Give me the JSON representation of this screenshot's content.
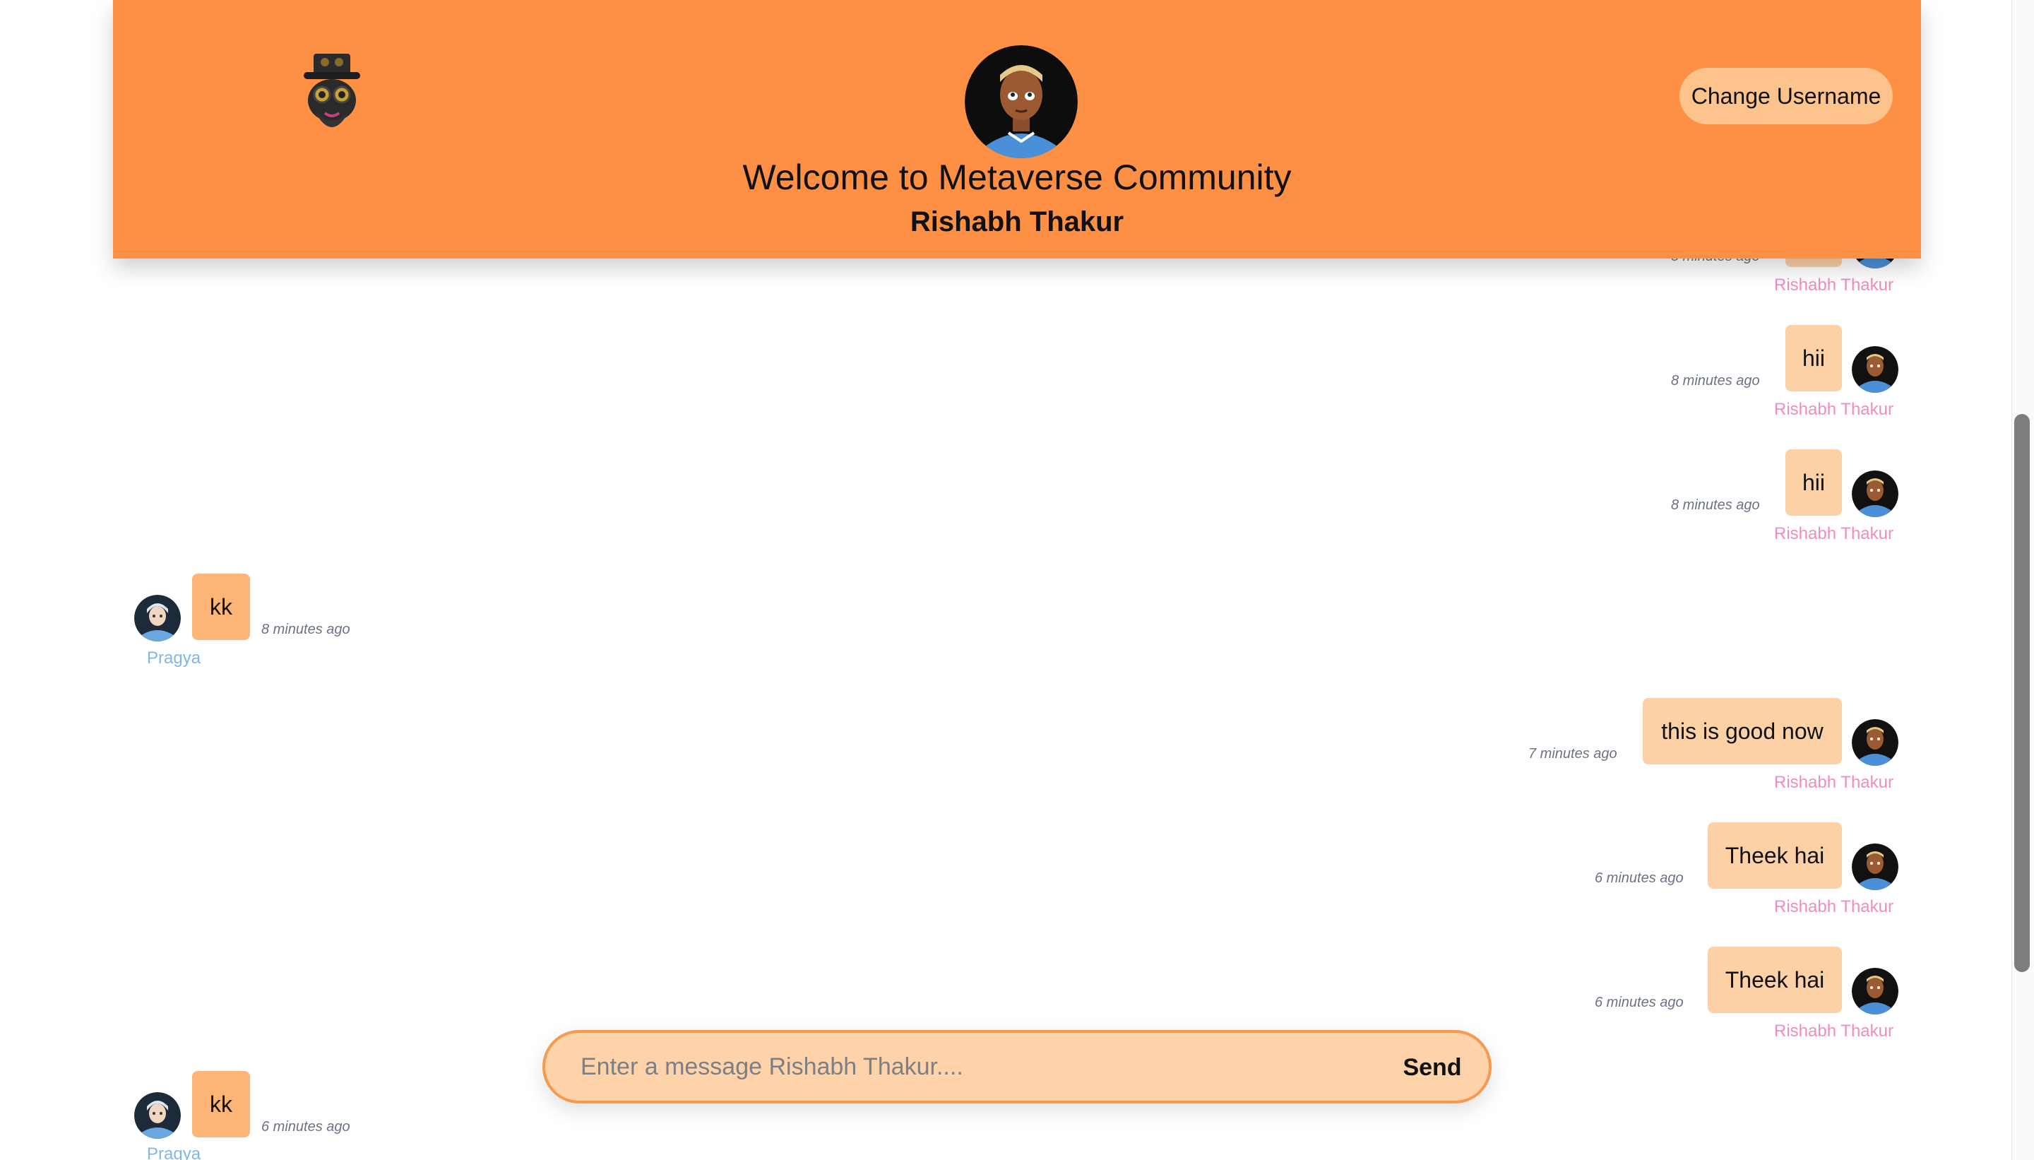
{
  "header": {
    "welcome_text": "Welcome to Metaverse Community",
    "username": "Rishabh Thakur",
    "change_username_label": "Change Username",
    "logo_icon": "steampunk-skull-logo",
    "background_color": "#fd9044"
  },
  "messages": [
    {
      "side": "right",
      "text": "",
      "time": "8 minutes ago",
      "author": "Rishabh Thakur"
    },
    {
      "side": "right",
      "text": "hii",
      "time": "8 minutes ago",
      "author": "Rishabh Thakur"
    },
    {
      "side": "right",
      "text": "hii",
      "time": "8 minutes ago",
      "author": "Rishabh Thakur"
    },
    {
      "side": "left",
      "text": "kk",
      "time": "8 minutes ago",
      "author": "Pragya"
    },
    {
      "side": "right",
      "text": "this is good now",
      "time": "7 minutes ago",
      "author": "Rishabh Thakur"
    },
    {
      "side": "right",
      "text": "Theek hai",
      "time": "6 minutes ago",
      "author": "Rishabh Thakur"
    },
    {
      "side": "right",
      "text": "Theek hai",
      "time": "6 minutes ago",
      "author": "Rishabh Thakur"
    },
    {
      "side": "left",
      "text": "kk",
      "time": "6 minutes ago",
      "author": "Pragya"
    }
  ],
  "composer": {
    "placeholder": "Enter a message Rishabh Thakur....",
    "value": "",
    "send_label": "Send"
  },
  "colors": {
    "self_bubble": "#fdd1a6",
    "other_bubble": "#fcb577",
    "self_name": "#f28bbf",
    "other_name": "#7fb7e6"
  }
}
